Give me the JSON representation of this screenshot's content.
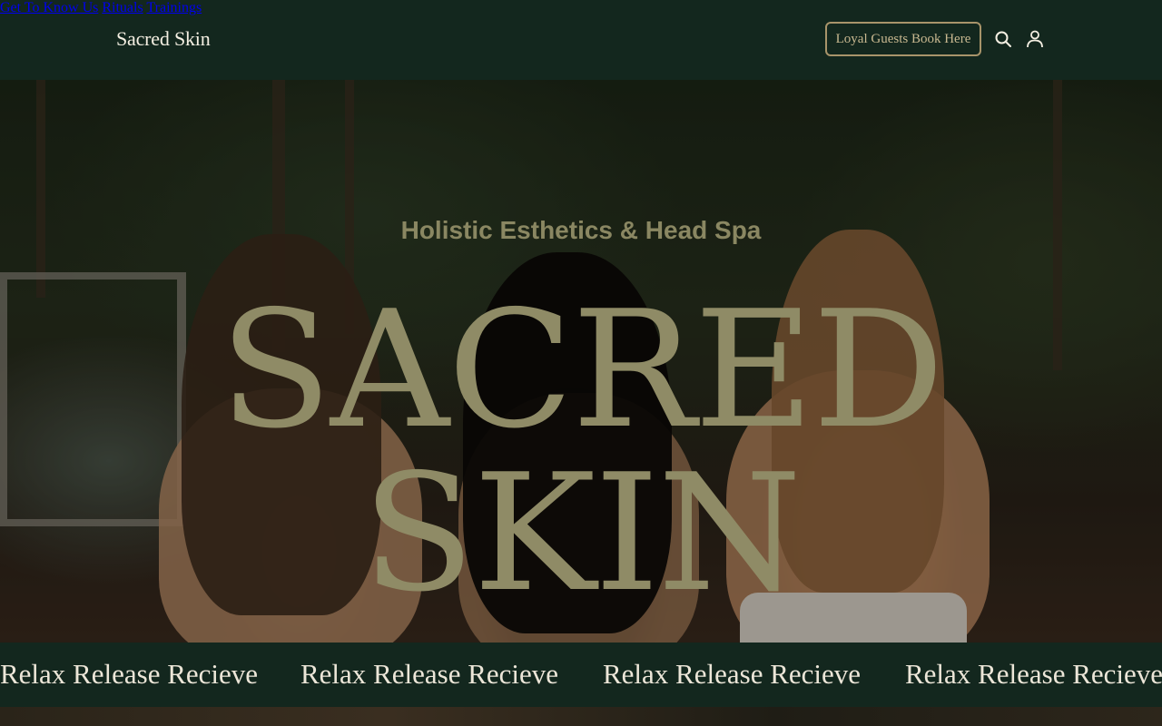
{
  "header": {
    "brand": "Sacred Skin",
    "nav": [
      "Get To Know Us",
      "Rituals",
      "Trainings"
    ],
    "cta_label": "Loyal Guests Book Here",
    "icons": [
      "search-icon",
      "account-icon"
    ]
  },
  "hero": {
    "subtitle": "Holistic Esthetics & Head Spa",
    "title": "SACRED SKIN"
  },
  "marquee": {
    "items": [
      "Relax Release Recieve",
      "Relax Release Recieve",
      "Relax Release Recieve",
      "Relax Release Recieve"
    ]
  },
  "colors": {
    "header_bg": "#13271e",
    "accent": "#a8946a",
    "title": "#8f8b66"
  }
}
